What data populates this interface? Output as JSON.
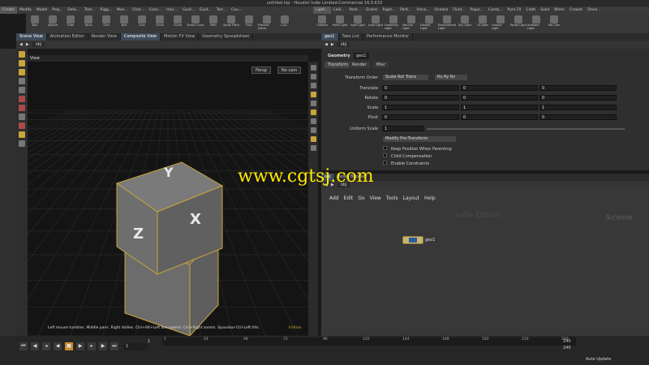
{
  "window_title": "untitled.hip - Houdini Indie Limited-Commercial 16.0.633",
  "shelf_tabs": [
    "Create",
    "Modify",
    "Model",
    "Poly...",
    "Defo...",
    "Text...",
    "Rigg...",
    "Mus...",
    "Char...",
    "Cons...",
    "Haic...",
    "Guid...",
    "Guid...",
    "Terr...",
    "Cou..."
  ],
  "shelf_tabs_right": [
    "Light...",
    "Colli...",
    "Parti...",
    "Grains",
    "Rigid...",
    "Parti...",
    "Visco...",
    "Oceans",
    "Fluid...",
    "Popul...",
    "Conta...",
    "Pyro FX",
    "Cloth",
    "Solid",
    "Wires",
    "Crowds",
    "Drive..."
  ],
  "left_tools": [
    "Box",
    "Sphere",
    "Tube",
    "Torus",
    "Grid",
    "Null",
    "Line",
    "Circle",
    "Curve",
    "Draw Curve",
    "Path",
    "Spray Paint",
    "Font",
    "Platonic Solids",
    "L-Sy..."
  ],
  "right_tools": [
    "Camera",
    "Point Light",
    "Spot Light",
    "Area Light",
    "Geometry Light",
    "Volume Light",
    "Distant Light",
    "Environment Light",
    "Sky Light",
    "GI Light",
    "Caustic Light",
    "Portal Light",
    "Ambient Light",
    "Ste Cam"
  ],
  "left_pane_tabs": [
    "Scene View",
    "Animation Editor",
    "Render View",
    "Composite View",
    "Motion FX View",
    "Geometry Spreadsheet"
  ],
  "path_obj": "obj",
  "viewport_title": "View",
  "persp": "Persp",
  "nocam": "No cam",
  "status_hint": "Left mouse tumbles. Middle pans. Right dollies. Ctrl+Alt+Left box-zooms. Ctrl+Right zooms. Spacebar-Ctrl-Left tilts.",
  "edition": "Edition",
  "cube_labels": {
    "top": "Y",
    "left": "Z",
    "right": "X"
  },
  "param_tabs_top": [
    "geo1",
    "Take List",
    "Performance Monitor"
  ],
  "param_node_type": "Geometry",
  "param_node_name": "geo1",
  "param_tabs": [
    "Transform",
    "Render",
    "Misc"
  ],
  "transform_order_label": "Transform Order",
  "transform_order_value": "Scale Rot Trans",
  "rot_order_value": "Rx Ry Rz",
  "rows": [
    {
      "label": "Translate",
      "v": [
        "0",
        "0",
        "0"
      ]
    },
    {
      "label": "Rotate",
      "v": [
        "0",
        "0",
        "0"
      ]
    },
    {
      "label": "Scale",
      "v": [
        "1",
        "1",
        "1"
      ]
    },
    {
      "label": "Pivot",
      "v": [
        "0",
        "0",
        "0"
      ]
    }
  ],
  "uniform_scale_label": "Uniform Scale",
  "uniform_scale_value": "1",
  "modify_pre": "Modify Pre-Transform",
  "checks": [
    "Keep Position When Parenting",
    "Child Compensation",
    "Enable Constraints"
  ],
  "net_tabs": [
    "Asset Browser"
  ],
  "net_path": "obj",
  "net_menu": [
    "Add",
    "Edit",
    "Go",
    "View",
    "Tools",
    "Layout",
    "Help"
  ],
  "indie_edition": "Indie Edition",
  "scene_label": "Scene",
  "node_name": "geo1",
  "watermark": "www.cgtsj.com",
  "timeline_ticks": [
    "1",
    "24",
    "48",
    "72",
    "96",
    "120",
    "144",
    "168",
    "192",
    "216",
    "240"
  ],
  "frame_start": "1",
  "frame_current": "1",
  "frame_end": "240",
  "frame_end2": "240",
  "auto_update": "Auto Update"
}
